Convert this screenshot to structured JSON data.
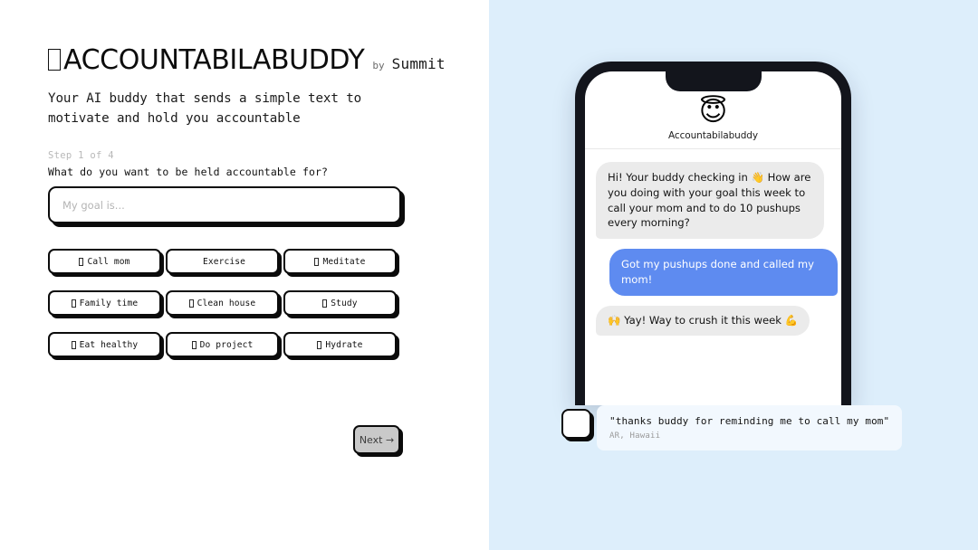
{
  "brand": {
    "emoji_placeholder": "missing-glyph-box",
    "title": "ACCOUNTABILABUDDY",
    "by_label": "by",
    "maker": "Summit",
    "tagline": "Your AI buddy that sends a simple text to motivate and hold you accountable"
  },
  "form": {
    "step_label": "Step 1 of 4",
    "question": "What do you want to be held accountable for?",
    "goal_value": "",
    "goal_placeholder": "My goal is...",
    "chips": [
      {
        "emoji": "missing-glyph-box",
        "label": "Call mom",
        "has_emoji": true
      },
      {
        "emoji": "",
        "label": "Exercise",
        "has_emoji": false
      },
      {
        "emoji": "missing-glyph-box",
        "label": "Meditate",
        "has_emoji": true
      },
      {
        "emoji": "missing-glyph-box",
        "label": "Family time",
        "has_emoji": true
      },
      {
        "emoji": "missing-glyph-box",
        "label": "Clean house",
        "has_emoji": true
      },
      {
        "emoji": "missing-glyph-box",
        "label": "Study",
        "has_emoji": true
      },
      {
        "emoji": "missing-glyph-box",
        "label": "Eat healthy",
        "has_emoji": true
      },
      {
        "emoji": "missing-glyph-box",
        "label": "Do project",
        "has_emoji": true
      },
      {
        "emoji": "missing-glyph-box",
        "label": "Hydrate",
        "has_emoji": true
      }
    ],
    "next_label": "Next →",
    "next_disabled": true
  },
  "preview": {
    "avatar_emoji": "😇",
    "contact_name": "Accountabilabuddy",
    "messages": [
      {
        "from": "buddy",
        "text": "Hi! Your buddy checking in 👋 How are you doing with your goal this week to call your mom and to do 10 pushups every morning?"
      },
      {
        "from": "user",
        "text": "Got my pushups done and called my mom!"
      },
      {
        "from": "buddy",
        "text": "🙌 Yay!  Way to crush it this week 💪"
      }
    ]
  },
  "testimonial": {
    "quote": "\"thanks buddy for reminding me to call my mom\"",
    "author": "AR, Hawaii"
  },
  "colors": {
    "right_panel_bg": "#ddeefb",
    "bubble_in": "#ebebeb",
    "bubble_out": "#5e8bf0",
    "ink": "#0b0b0b",
    "disabled_button": "#c9c9c9",
    "testimonial_card": "#f2f8fe"
  }
}
